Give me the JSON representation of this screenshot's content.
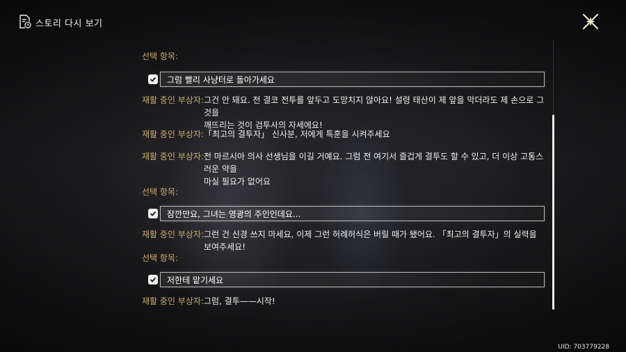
{
  "header": {
    "title": "스토리 다시 보기",
    "icon": "document-history-icon"
  },
  "close": {
    "icon": "close-x-icon"
  },
  "choice_label": "선택 항목:",
  "speaker": "재활 중인 부상자:",
  "choices": [
    "그럼 빨리 사냥터로 돌아가세요",
    "잠깐만요, 그녀는 영광의 주인인데요...",
    "저한테 맡기세요"
  ],
  "dialogue": [
    {
      "line1": "그건 안 돼요. 전 결코 전투를 앞두고 도망치지 않아요! 설령 태산이 제 앞을 막더라도 제 손으로 그것을",
      "line2": "깨뜨리는 것이 검투사의 자세에요!"
    },
    {
      "line1": "「최고의 결투자」 신사분, 저에게 특훈을 시켜주세요",
      "line2": ""
    },
    {
      "line1": "전 마르시아 의사 선생님을 이길 거예요. 그럼 전 여기서 즐겁게 결투도 할 수 있고, 더 이상 고통스러운 약을",
      "line2": "마실 필요가 없어요"
    },
    {
      "line1": "그런 건 신경 쓰지 마세요, 이제 그런 허례허식은 버릴 때가 됐어요. 「최고의 결투자」의 실력을 보여주세요!",
      "line2": ""
    },
    {
      "line1": "그럼, 결투——시작!",
      "line2": ""
    }
  ],
  "uid": "UID: 703779228",
  "colors": {
    "speaker": "#c9ad6e",
    "text": "#f0f0f0",
    "accent_gold": "#c9ad6e"
  }
}
